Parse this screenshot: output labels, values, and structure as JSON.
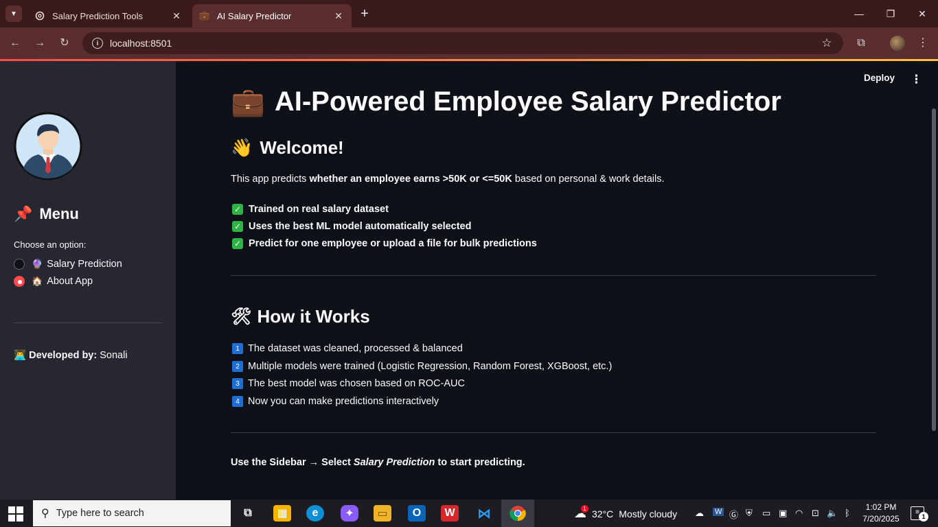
{
  "browser": {
    "tabs": [
      {
        "title": "Salary Prediction Tools",
        "favicon": "openai-icon",
        "active": false
      },
      {
        "title": "AI Salary Predictor",
        "favicon": "briefcase-icon",
        "active": true
      }
    ],
    "url": "localhost:8501",
    "new_tab_glyph": "+",
    "minimize_glyph": "—",
    "restore_glyph": "❐",
    "close_glyph": "✕",
    "tab_close_glyph": "✕"
  },
  "app": {
    "accent_color": "#ff4b4b",
    "deploy_label": "Deploy",
    "sidebar": {
      "menu_title": "Menu",
      "menu_emoji": "📌",
      "radio_label": "Choose an option:",
      "options": [
        {
          "emoji": "🔮",
          "label": "Salary Prediction",
          "selected": false
        },
        {
          "emoji": "🏠",
          "label": "About App",
          "selected": true
        }
      ],
      "developer_emoji": "👨‍💻",
      "developer_label": "Developed by:",
      "developer_name": "Sonali"
    },
    "main": {
      "title_emoji": "💼",
      "title": "AI-Powered Employee Salary Predictor",
      "welcome_emoji": "👋",
      "welcome_heading": "Welcome!",
      "intro_prefix": "This app predicts ",
      "intro_bold": "whether an employee earns >50K or <=50K",
      "intro_suffix": " based on personal & work details.",
      "features": [
        "Trained on real salary dataset",
        "Uses the best ML model automatically selected",
        "Predict for one employee or upload a file for bulk predictions"
      ],
      "how_emoji": "🛠",
      "how_heading": "How it Works",
      "steps": [
        {
          "num": "1",
          "text": "The dataset was cleaned, processed & balanced"
        },
        {
          "num": "2",
          "text": "Multiple models were trained (Logistic Regression, Random Forest, XGBoost, etc.)"
        },
        {
          "num": "3",
          "text": "The best model was chosen based on ROC-AUC"
        },
        {
          "num": "4",
          "text": "Now you can make predictions interactively"
        }
      ],
      "footer_prefix": "Use the Sidebar → Select ",
      "footer_italic": "Salary Prediction",
      "footer_suffix": " to start predicting."
    }
  },
  "taskbar": {
    "search_placeholder": "Type here to search",
    "weather_temp": "32°C",
    "weather_desc": "Mostly cloudy",
    "weather_badge": "1",
    "time": "1:02 PM",
    "date": "7/20/2025",
    "notification_count": "1"
  }
}
